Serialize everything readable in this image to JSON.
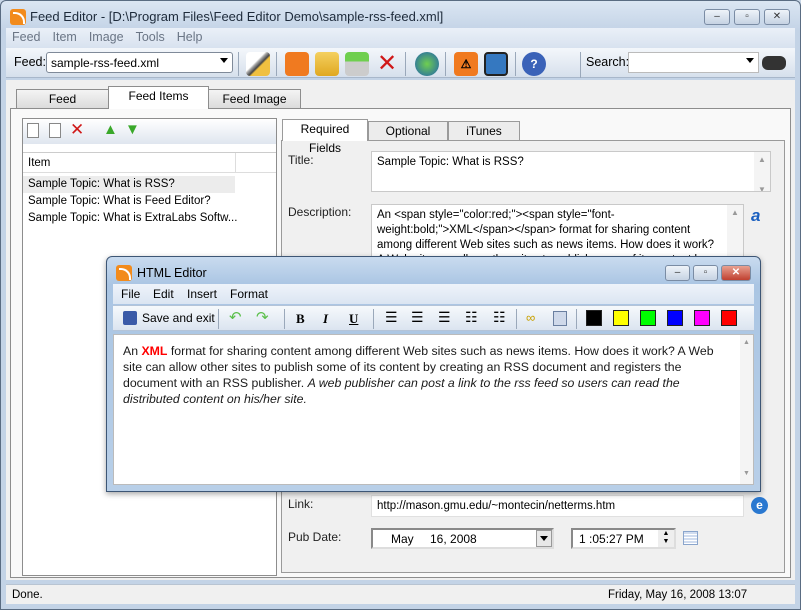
{
  "window": {
    "title": "Feed Editor - [D:\\Program Files\\Feed Editor Demo\\sample-rss-feed.xml]"
  },
  "menu": [
    "Feed",
    "Item",
    "Image",
    "Tools",
    "Help"
  ],
  "toolbar": {
    "feed_label": "Feed:",
    "feed_value": "sample-rss-feed.xml",
    "search_label": "Search:",
    "search_value": ""
  },
  "tabs": [
    "Feed",
    "Feed Items",
    "Feed Image"
  ],
  "items": {
    "header": "Item",
    "rows": [
      "Sample Topic: What is RSS?",
      "Sample Topic: What is Feed Editor?",
      "Sample Topic: What is ExtraLabs Softw..."
    ]
  },
  "subtabs": [
    "Required Fields",
    "Optional Fields",
    "iTunes Fields"
  ],
  "fields": {
    "title_label": "Title:",
    "title_value": "Sample Topic: What is RSS?",
    "desc_label": "Description:",
    "desc_value": "An <span style=\"color:red;\"><span style=\"font-weight:bold;\">XML</span></span> format for sharing content among different Web sites such as news items. How does it work? A Web site can allow other sites to publish some of its content by creating an RSS",
    "link_label": "Link:",
    "link_value": "http://mason.gmu.edu/~montecin/netterms.htm",
    "pubdate_label": "Pub Date:",
    "date_month": "May",
    "date_day": "16, 2008",
    "time_value": "1 :05:27 PM"
  },
  "html_editor": {
    "title": "HTML Editor",
    "menu": [
      "File",
      "Edit",
      "Insert",
      "Format"
    ],
    "save_label": "Save and exit",
    "format_buttons": {
      "bold": "B",
      "italic": "I",
      "underline": "U"
    },
    "colors": [
      "#000000",
      "#ffff00",
      "#00ff00",
      "#0000ff",
      "#ff00ff",
      "#ff0000"
    ],
    "content": {
      "t1": "An ",
      "t2": "XML",
      "t3": " format for sharing content among different Web sites such as news items. How does it work? A Web site can allow other sites to publish some of its content by creating an RSS document and registers the document with an RSS publisher. ",
      "t4": "A web publisher can post a link to the rss feed so users can read the distributed content on his/her site."
    }
  },
  "status": {
    "left": "Done.",
    "right": "Friday, May 16, 2008 13:07"
  }
}
